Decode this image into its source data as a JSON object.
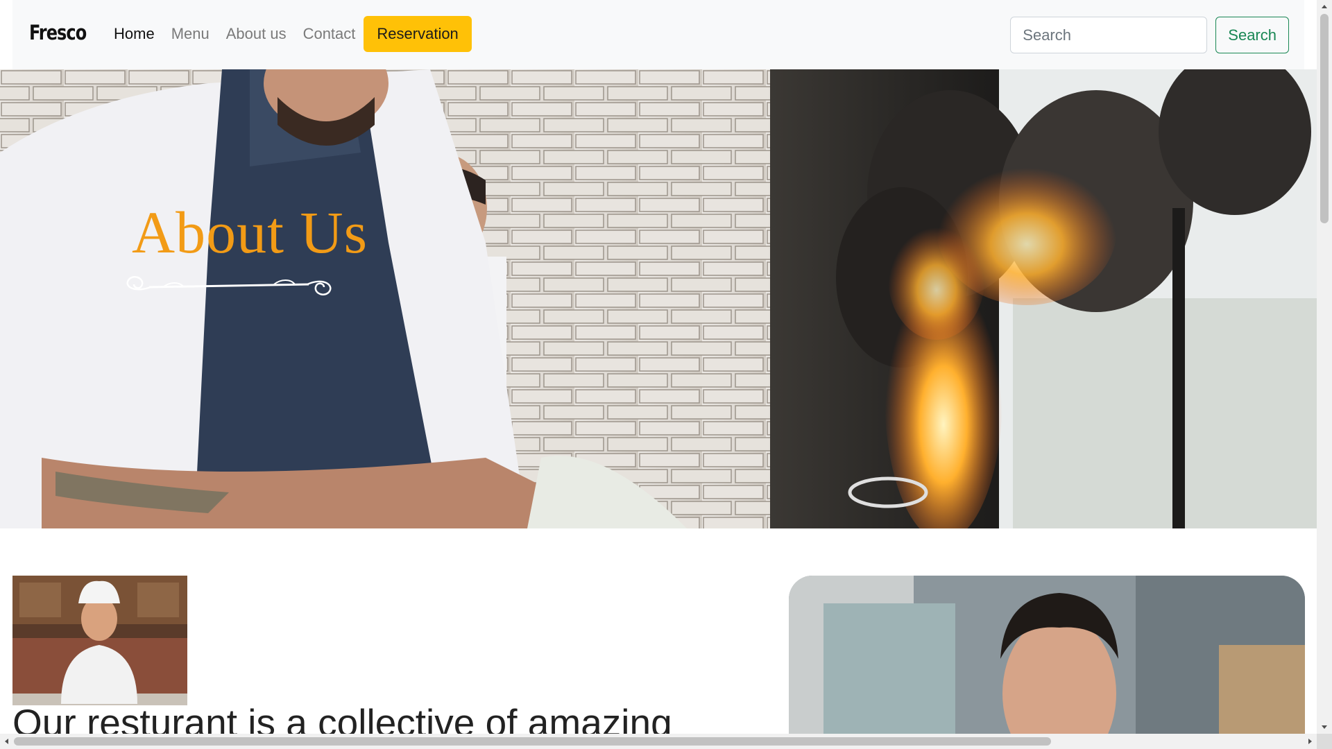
{
  "navbar": {
    "brand": "Fresco",
    "links": [
      {
        "label": "Home",
        "active": true
      },
      {
        "label": "Menu",
        "active": false
      },
      {
        "label": "About us",
        "active": false
      },
      {
        "label": "Contact",
        "active": false
      }
    ],
    "reservation_label": "Reservation",
    "search": {
      "placeholder": "Search",
      "button_label": "Search"
    }
  },
  "hero": {
    "title": "About Us",
    "image": "chefs-cooking-kitchen-flames-photo",
    "title_color": "#f29b16"
  },
  "content": {
    "thumb_image": "smiling-chef-in-white-hat-photo",
    "heading": "Our resturant is a collective of amazing",
    "photo_image": "smiling-chef-portrait-photo"
  },
  "colors": {
    "reservation": "#ffc107",
    "search_button": "#198754",
    "navbar_bg": "#f8f9fa"
  }
}
